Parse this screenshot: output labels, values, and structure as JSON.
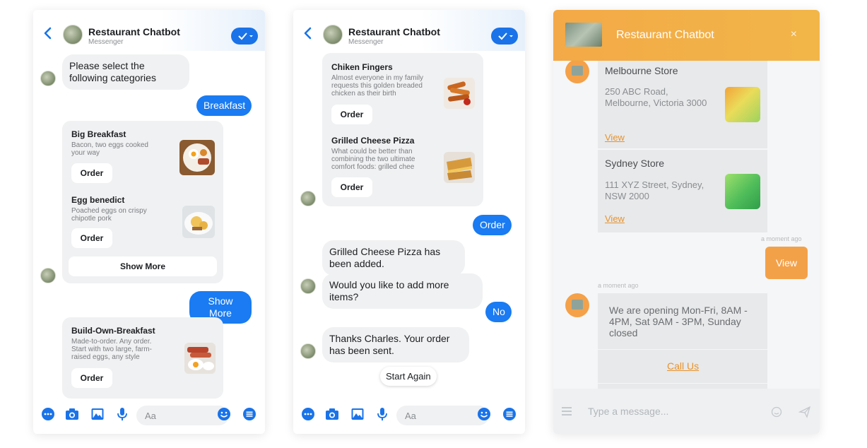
{
  "panel1": {
    "title": "Restaurant Chatbot",
    "subtitle": "Messenger",
    "bot_message_1": "Please select the following categories",
    "user_reply_1": "Breakfast",
    "items": [
      {
        "title": "Big Breakfast",
        "desc": "Bacon, two eggs cooked your way",
        "order_label": "Order"
      },
      {
        "title": "Egg benedict",
        "desc": "Poached eggs on crispy chipotle pork",
        "order_label": "Order"
      }
    ],
    "show_more_button": "Show More",
    "user_reply_2": "Show More",
    "item3": {
      "title": "Build-Own-Breakfast",
      "desc": "Made-to-order. Any order. Start with two large, farm-raised eggs, any style",
      "order_label": "Order"
    },
    "composer_placeholder": "Aa"
  },
  "panel2": {
    "title": "Restaurant Chatbot",
    "subtitle": "Messenger",
    "items": [
      {
        "title": "Chiken Fingers",
        "desc": "Almost everyone in my family requests this golden breaded chicken as their birth",
        "order_label": "Order"
      },
      {
        "title": "Grilled Cheese Pizza",
        "desc": "What could be better than combining the two ultimate comfort foods: grilled chee",
        "order_label": "Order"
      }
    ],
    "user_reply_1": "Order",
    "bot_message_1": "Grilled Cheese Pizza has been added.",
    "bot_message_2": "Would you like to add more items?",
    "user_reply_2": "No",
    "bot_message_3": "Thanks Charles. Your order has been sent.",
    "quick_reply": "Start Again",
    "composer_placeholder": "Aa"
  },
  "panel3": {
    "title": "Restaurant Chatbot",
    "close_glyph": "×",
    "stores": [
      {
        "name": "Melbourne Store",
        "address": "250 ABC Road, Melbourne, Victoria 3000",
        "view_label": "View"
      },
      {
        "name": "Sydney Store",
        "address": "111 XYZ Street, Sydney, NSW 2000",
        "view_label": "View"
      }
    ],
    "timestamp_1": "a moment ago",
    "user_view_button": "View",
    "timestamp_2": "a moment ago",
    "hours_message": "We are opening Mon-Fri, 8AM - 4PM, Sat 9AM - 3PM, Sunday closed",
    "call_us_label": "Call Us",
    "composer_placeholder": "Type a message..."
  },
  "colors": {
    "messenger_blue": "#1a7bf2",
    "widget_orange": "#f3a947",
    "link_orange": "#e8922c"
  }
}
